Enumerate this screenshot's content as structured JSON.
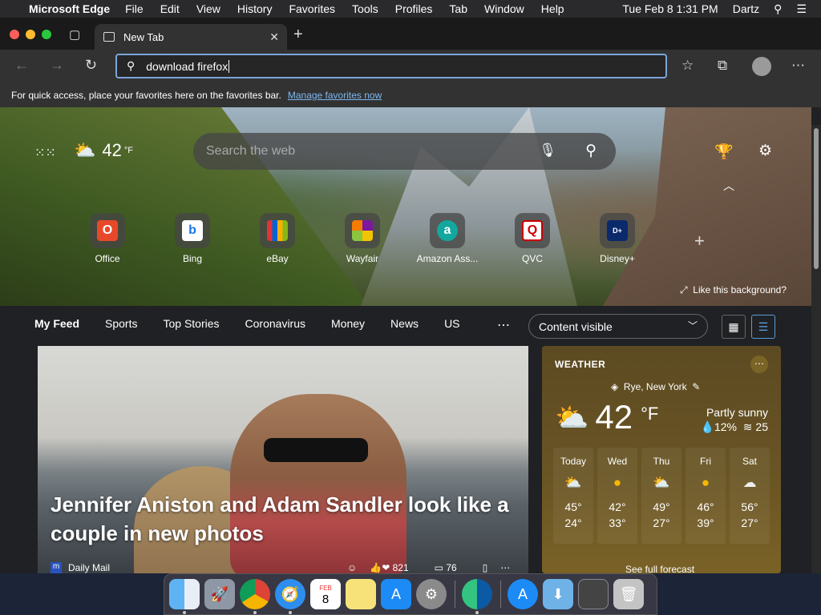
{
  "menubar": {
    "app_name": "Microsoft Edge",
    "menus": [
      "File",
      "Edit",
      "View",
      "History",
      "Favorites",
      "Tools",
      "Profiles",
      "Tab",
      "Window",
      "Help"
    ],
    "datetime": "Tue Feb 8  1:31 PM",
    "user": "Dartz"
  },
  "tab": {
    "title": "New Tab"
  },
  "address_bar": {
    "value": "download firefox"
  },
  "favorites_bar": {
    "message": "For quick access, place your favorites here on the favorites bar.",
    "link": "Manage favorites now"
  },
  "hero": {
    "temperature": "42",
    "temp_unit": "°F",
    "search_placeholder": "Search the web",
    "like_background": "Like this background?"
  },
  "quick_links": [
    {
      "label": "Office",
      "icon": "office-icon",
      "color": "#e8482a"
    },
    {
      "label": "Bing",
      "icon": "bing-icon",
      "color": "#1a73e8"
    },
    {
      "label": "eBay",
      "icon": "ebay-icon",
      "color": "#e53238"
    },
    {
      "label": "Wayfair",
      "icon": "wayfair-icon",
      "color": "#7b189f"
    },
    {
      "label": "Amazon Ass...",
      "icon": "amazon-assistant-icon",
      "color": "#13a89e"
    },
    {
      "label": "QVC",
      "icon": "qvc-icon",
      "color": "#ffffff"
    },
    {
      "label": "Disney+",
      "icon": "disney-plus-icon",
      "color": "#0a2a6c"
    }
  ],
  "feed": {
    "tabs": [
      "My Feed",
      "Sports",
      "Top Stories",
      "Coronavirus",
      "Money",
      "News",
      "US"
    ],
    "content_visibility": "Content visible"
  },
  "news_card": {
    "headline": "Jennifer Aniston and Adam Sandler look like a couple in new photos",
    "source": "Daily Mail",
    "reactions": "821",
    "comments": "76"
  },
  "weather": {
    "heading": "WEATHER",
    "location": "Rye, New York",
    "temperature": "42",
    "unit": "°F",
    "condition": "Partly sunny",
    "precip": "12%",
    "wind": "25",
    "forecast": [
      {
        "day": "Today",
        "high": "45°",
        "low": "24°",
        "icon": "partly-cloudy-icon"
      },
      {
        "day": "Wed",
        "high": "42°",
        "low": "33°",
        "icon": "sunny-icon"
      },
      {
        "day": "Thu",
        "high": "49°",
        "low": "27°",
        "icon": "partly-cloudy-icon"
      },
      {
        "day": "Fri",
        "high": "46°",
        "low": "39°",
        "icon": "sunny-icon"
      },
      {
        "day": "Sat",
        "high": "56°",
        "low": "27°",
        "icon": "cloudy-icon"
      }
    ],
    "see_full": "See full forecast"
  },
  "dock": {
    "apps": [
      "Finder",
      "Launchpad",
      "Google Chrome",
      "Safari",
      "Calendar",
      "Notes",
      "App Store",
      "System Preferences",
      "Microsoft Edge",
      "App Store Downloads",
      "Downloads",
      "Screenshot",
      "Trash"
    ],
    "calendar_month": "FEB",
    "calendar_day": "8"
  }
}
